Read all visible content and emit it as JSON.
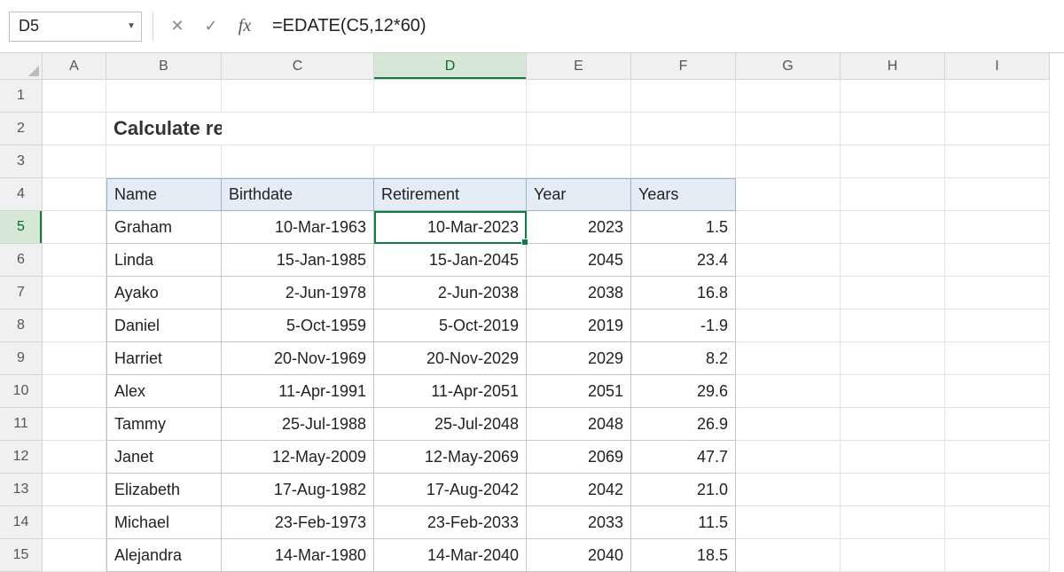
{
  "namebox": "D5",
  "formula": "=EDATE(C5,12*60)",
  "cancel_symbol": "✕",
  "confirm_symbol": "✓",
  "fx_symbol": "fx",
  "columns": [
    "A",
    "B",
    "C",
    "D",
    "E",
    "F",
    "G",
    "H",
    "I"
  ],
  "rows_shown": [
    "1",
    "2",
    "3",
    "4",
    "5",
    "6",
    "7",
    "8",
    "9",
    "10",
    "11",
    "12",
    "13",
    "14",
    "15"
  ],
  "selected_cell": {
    "col": "D",
    "row": "5"
  },
  "title": "Calculate retirement date",
  "table_headers": {
    "name": "Name",
    "birth": "Birthdate",
    "retire": "Retirement",
    "year": "Year",
    "years": "Years"
  },
  "table_rows": [
    {
      "name": "Graham",
      "birth": "10-Mar-1963",
      "retire": "10-Mar-2023",
      "year": "2023",
      "years": "1.5"
    },
    {
      "name": "Linda",
      "birth": "15-Jan-1985",
      "retire": "15-Jan-2045",
      "year": "2045",
      "years": "23.4"
    },
    {
      "name": "Ayako",
      "birth": "2-Jun-1978",
      "retire": "2-Jun-2038",
      "year": "2038",
      "years": "16.8"
    },
    {
      "name": "Daniel",
      "birth": "5-Oct-1959",
      "retire": "5-Oct-2019",
      "year": "2019",
      "years": "-1.9"
    },
    {
      "name": "Harriet",
      "birth": "20-Nov-1969",
      "retire": "20-Nov-2029",
      "year": "2029",
      "years": "8.2"
    },
    {
      "name": "Alex",
      "birth": "11-Apr-1991",
      "retire": "11-Apr-2051",
      "year": "2051",
      "years": "29.6"
    },
    {
      "name": "Tammy",
      "birth": "25-Jul-1988",
      "retire": "25-Jul-2048",
      "year": "2048",
      "years": "26.9"
    },
    {
      "name": "Janet",
      "birth": "12-May-2009",
      "retire": "12-May-2069",
      "year": "2069",
      "years": "47.7"
    },
    {
      "name": "Elizabeth",
      "birth": "17-Aug-1982",
      "retire": "17-Aug-2042",
      "year": "2042",
      "years": "21.0"
    },
    {
      "name": "Michael",
      "birth": "23-Feb-1973",
      "retire": "23-Feb-2033",
      "year": "2033",
      "years": "11.5"
    },
    {
      "name": "Alejandra",
      "birth": "14-Mar-1980",
      "retire": "14-Mar-2040",
      "year": "2040",
      "years": "18.5"
    }
  ]
}
